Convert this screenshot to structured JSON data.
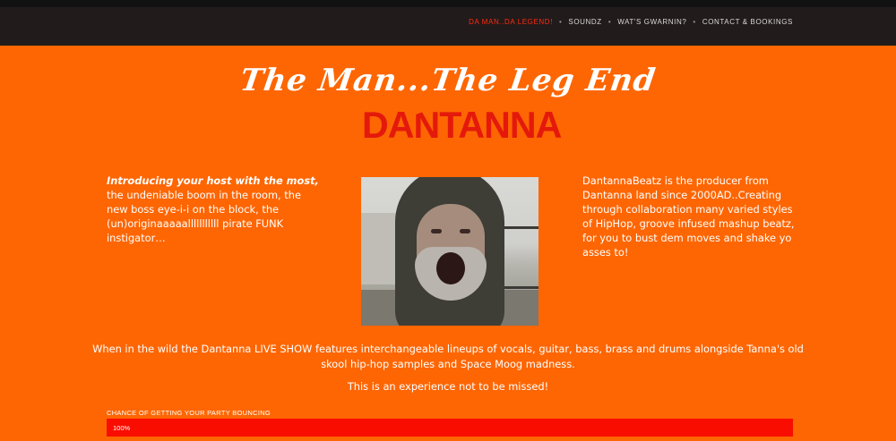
{
  "nav": {
    "items": [
      {
        "label": "DA MAN..DA LEGEND!"
      },
      {
        "label": "SOUNDZ"
      },
      {
        "label": "WAT'S GWARNIN?"
      },
      {
        "label": "CONTACT & BOOKINGS"
      }
    ],
    "separator": "•",
    "active_color": "#ff2a10"
  },
  "hero": {
    "script_title": "The Man...The Leg End",
    "logo_text": "DANTANNA"
  },
  "intro": {
    "lead": "Introducing your host with the most,",
    "text": " the undeniable boom in the room, the new boss eye-i-i on the block, the (un)originaaaaalllllllllll pirate FUNK instigator…"
  },
  "bio": {
    "text": "DantannaBeatz is the producer from Dantanna land since 2000AD..Creating through collaboration many varied styles of HipHop, groove infused mashup beatz, for you to bust dem moves and shake yo asses to!"
  },
  "live": {
    "text": "When in the wild the Dantanna LIVE SHOW features interchangeable lineups of vocals, guitar, bass, brass and drums alongside Tanna's old skool hip-hop samples and Space Moog madness.",
    "experience": "This is an experience not to be missed!"
  },
  "progress": {
    "label": "CHANCE OF GETTING YOUR PARTY BOUNCING",
    "value_text": "100%",
    "value": 1.0,
    "fill_color": "#f90d00"
  },
  "colors": {
    "background": "#fe6603",
    "navbar": "#221b1b",
    "logo": "#e4190b"
  }
}
